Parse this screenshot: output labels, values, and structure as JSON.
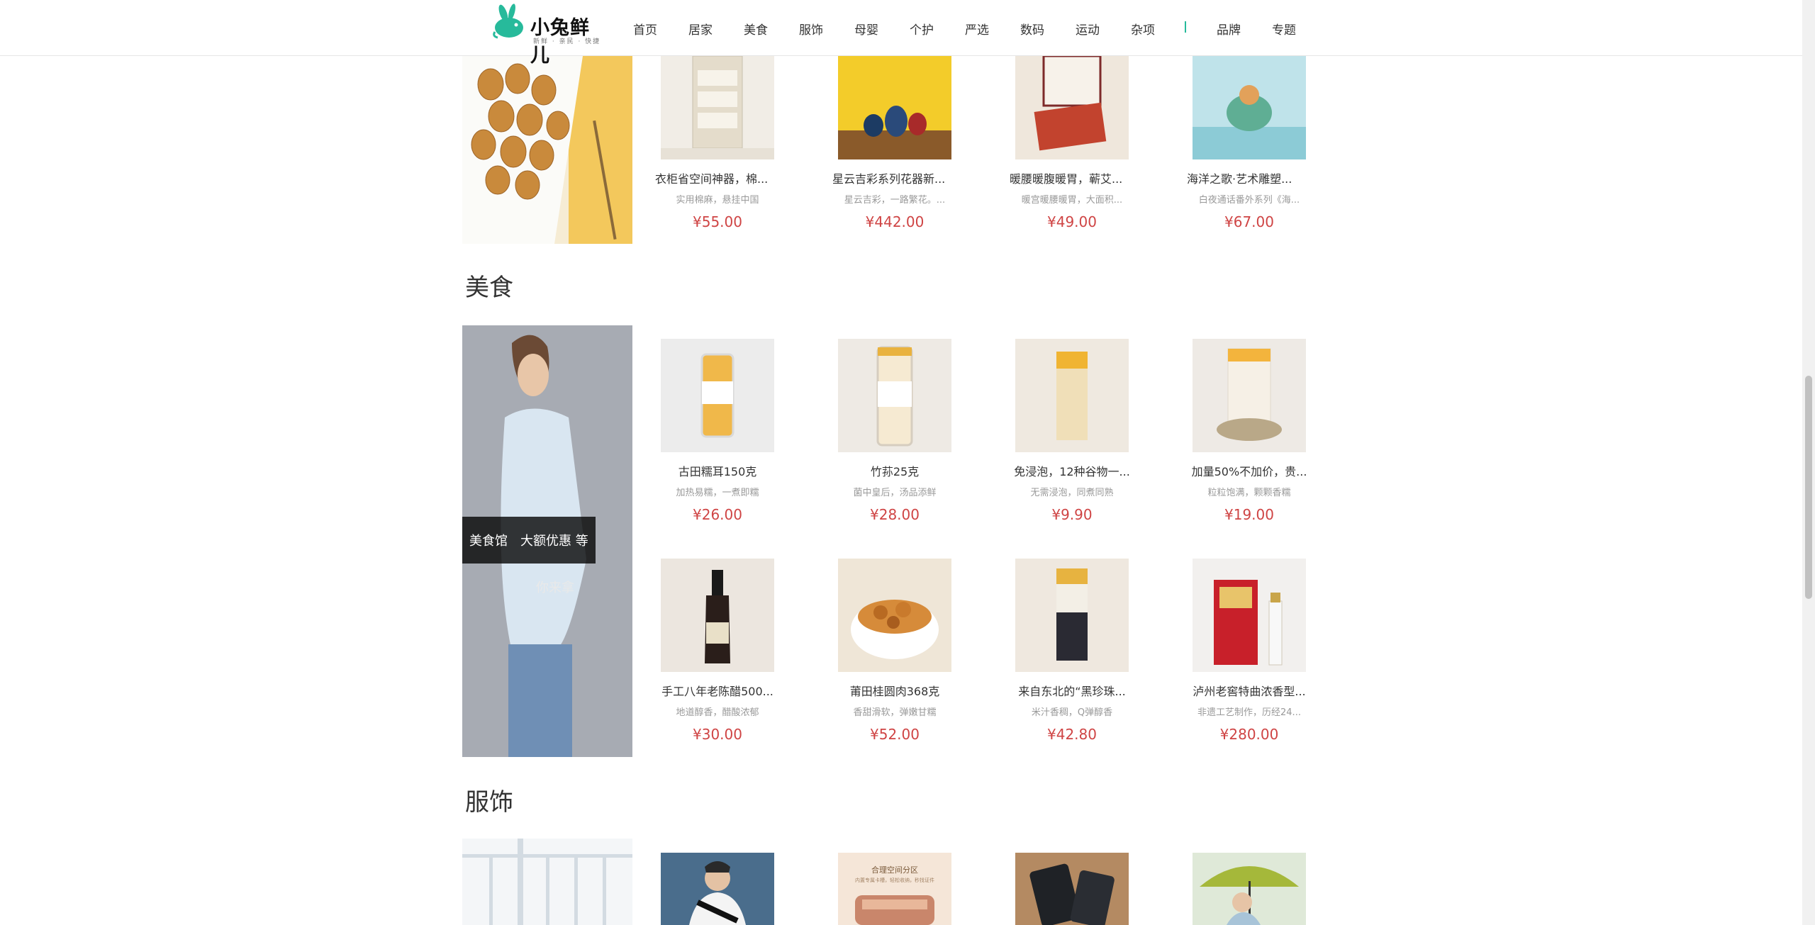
{
  "header": {
    "logo_text": "小兔鲜儿",
    "logo_sub": "新鲜 · 亲民 · 快捷",
    "nav": [
      "首页",
      "居家",
      "美食",
      "服饰",
      "母婴",
      "个护",
      "严选",
      "数码",
      "运动",
      "杂项"
    ],
    "nav_right": [
      "品牌",
      "专题"
    ]
  },
  "colors": {
    "brand": "#27ba9b",
    "price": "#cf4444",
    "banner_label_bg": "#1a1a1a"
  },
  "home_section": {
    "products": [
      {
        "name": "衣柜省空间神器，棉...",
        "desc": "实用棉麻，悬挂中国",
        "price": "¥55.00"
      },
      {
        "name": "星云吉彩系列花器新...",
        "desc": "星云吉彩，一路繁花。...",
        "price": "¥442.00"
      },
      {
        "name": "暖腰暖腹暖胃，蕲艾...",
        "desc": "暖宫暖腰暖胃，大面积...",
        "price": "¥49.00"
      },
      {
        "name": "海洋之歌·艺术雕塑...",
        "desc": "白夜通话番外系列《海...",
        "price": "¥67.00"
      }
    ]
  },
  "food_section": {
    "title": "美食",
    "banner": {
      "label_a": "美食馆",
      "label_b": "大额优惠 等",
      "sub": "你来拿"
    },
    "products": [
      {
        "name": "古田糯耳150克",
        "desc": "加热易糯，一煮即糯",
        "price": "¥26.00"
      },
      {
        "name": "竹荪25克",
        "desc": "菌中皇后，汤品添鲜",
        "price": "¥28.00"
      },
      {
        "name": "免浸泡，12种谷物一...",
        "desc": "无需浸泡，同煮同熟",
        "price": "¥9.90"
      },
      {
        "name": "加量50%不加价，贵...",
        "desc": "粒粒饱满，颗颗香糯",
        "price": "¥19.00"
      },
      {
        "name": "手工八年老陈醋500...",
        "desc": "地道醇香，醋酸浓郁",
        "price": "¥30.00"
      },
      {
        "name": "莆田桂圆肉368克",
        "desc": "香甜滑软，弹嫩甘糯",
        "price": "¥52.00"
      },
      {
        "name": "来自东北的“黑珍珠...",
        "desc": "米汁香稠，Q弹醇香",
        "price": "¥42.80"
      },
      {
        "name": "泸州老窖特曲浓香型...",
        "desc": "非遗工艺制作，历经24...",
        "price": "¥280.00"
      }
    ]
  },
  "clothing_section": {
    "title": "服饰",
    "promo_title": "合理空间分区",
    "promo_sub": "内置专属卡槽，轻松收纳，秒找证件"
  }
}
